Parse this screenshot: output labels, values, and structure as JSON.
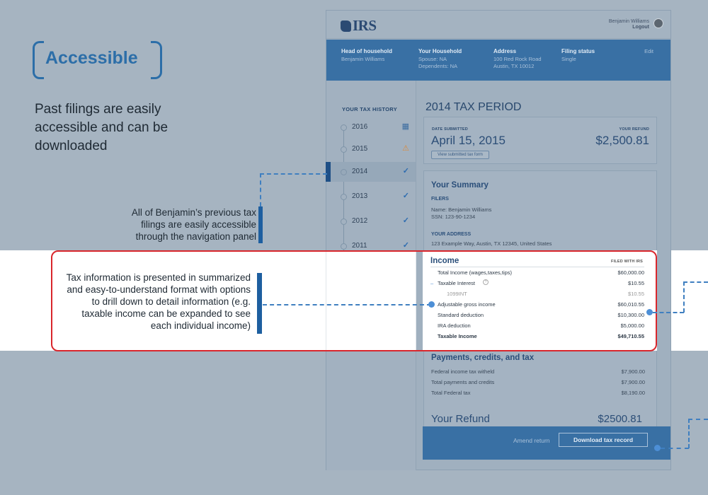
{
  "annotations": {
    "title": "Accessible",
    "description": "Past filings are easily accessible and can be downloaded",
    "note_navigation": "All of Benjamin’s previous tax filings are easily accessible through the navigation panel",
    "note_summary": "Tax information is presented in summarized and easy-to-understand format with options to drill down to detail information (e.g. taxable income can be expanded to see each individual income)"
  },
  "header": {
    "logo": "IRS",
    "user_name": "Benjamin Williams",
    "logout": "Logout"
  },
  "infobar": {
    "columns": [
      {
        "label": "Head of household",
        "lines": [
          "Benjamin Williams"
        ]
      },
      {
        "label": "Your Household",
        "lines": [
          "Spouse: NA",
          "Dependents: NA"
        ]
      },
      {
        "label": "Address",
        "lines": [
          "100 Red Rock Road",
          "Austin, TX 10012"
        ]
      },
      {
        "label": "Filing status",
        "lines": [
          "Single"
        ]
      }
    ],
    "edit": "Edit"
  },
  "sidebar": {
    "title": "YOUR TAX HISTORY",
    "items": [
      {
        "year": "2016",
        "status": "calendar-icon"
      },
      {
        "year": "2015",
        "status": "warning-icon"
      },
      {
        "year": "2014",
        "status": "check-icon",
        "active": true
      },
      {
        "year": "2013",
        "status": "check-icon"
      },
      {
        "year": "2012",
        "status": "check-icon"
      },
      {
        "year": "2011",
        "status": "check-icon"
      }
    ]
  },
  "period": {
    "title": "2014 TAX PERIOD",
    "date_label": "DATE SUBMITTED",
    "date": "April 15, 2015",
    "refund_label": "YOUR REFUND",
    "refund": "$2,500.81",
    "view_button": "View submitted tax form"
  },
  "summary": {
    "title": "Your Summary",
    "filers_label": "FILERS",
    "filer_name": "Name: Benjamin Williams",
    "filer_ssn": "SSN: 123-90-1234",
    "address_label": "YOUR ADDRESS",
    "address": "123 Example Way, Austin, TX 12345, United States"
  },
  "income": {
    "title": "Income",
    "filed_label": "FILED WITH IRS",
    "rows": [
      {
        "label": "Total Income (wages,taxes,tips)",
        "value": "$60,000.00"
      },
      {
        "label": "Taxable Interest",
        "value": "$10.55",
        "expanded": true
      },
      {
        "label": "1099INT",
        "value": "$10.55",
        "muted": true
      },
      {
        "label": "Adjustable gross income",
        "value": "$60,010.55"
      },
      {
        "label": "Standard deduction",
        "value": "$10,300.00"
      },
      {
        "label": "IRA deduction",
        "value": "$5,000.00"
      },
      {
        "label": "Taxable Income",
        "value": "$49,710.55",
        "bold": true
      }
    ],
    "collapse_symbol": "–",
    "info_symbol": "?"
  },
  "payments": {
    "title": "Payments, credits, and tax",
    "rows": [
      {
        "label": "Federal income tax witheld",
        "value": "$7,900.00"
      },
      {
        "label": "Total payments and credits",
        "value": "$7,900.00"
      },
      {
        "label": "Total Federal tax",
        "value": "$8,190.00"
      }
    ]
  },
  "refund": {
    "label": "Your Refund",
    "value": "$2500.81"
  },
  "footer": {
    "amend": "Amend return",
    "download": "Download tax record"
  },
  "colors": {
    "accent": "#2c6ea8",
    "infobar": "#3970a4",
    "highlight_border": "#d9262c"
  }
}
